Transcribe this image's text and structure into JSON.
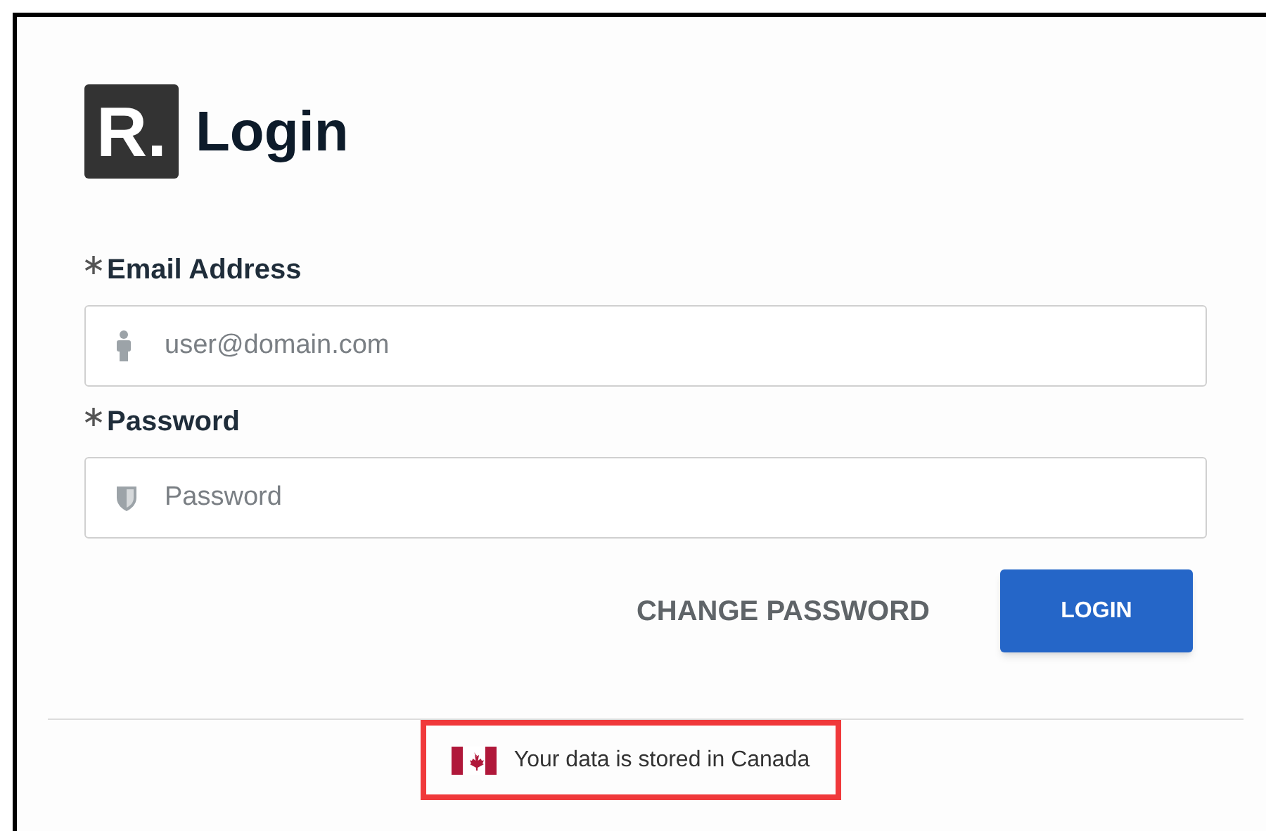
{
  "logo": {
    "text": "R."
  },
  "title": "Login",
  "fields": [
    {
      "label": "Email Address",
      "required": true,
      "placeholder": "user@domain.com",
      "kind": "person"
    },
    {
      "label": "Password",
      "required": true,
      "placeholder": "Password",
      "kind": "shield"
    }
  ],
  "actions": {
    "secondary": "CHANGE PASSWORD",
    "primary": "LOGIN"
  },
  "footer": {
    "text": "Your data is stored in Canada",
    "highlighted": true
  }
}
